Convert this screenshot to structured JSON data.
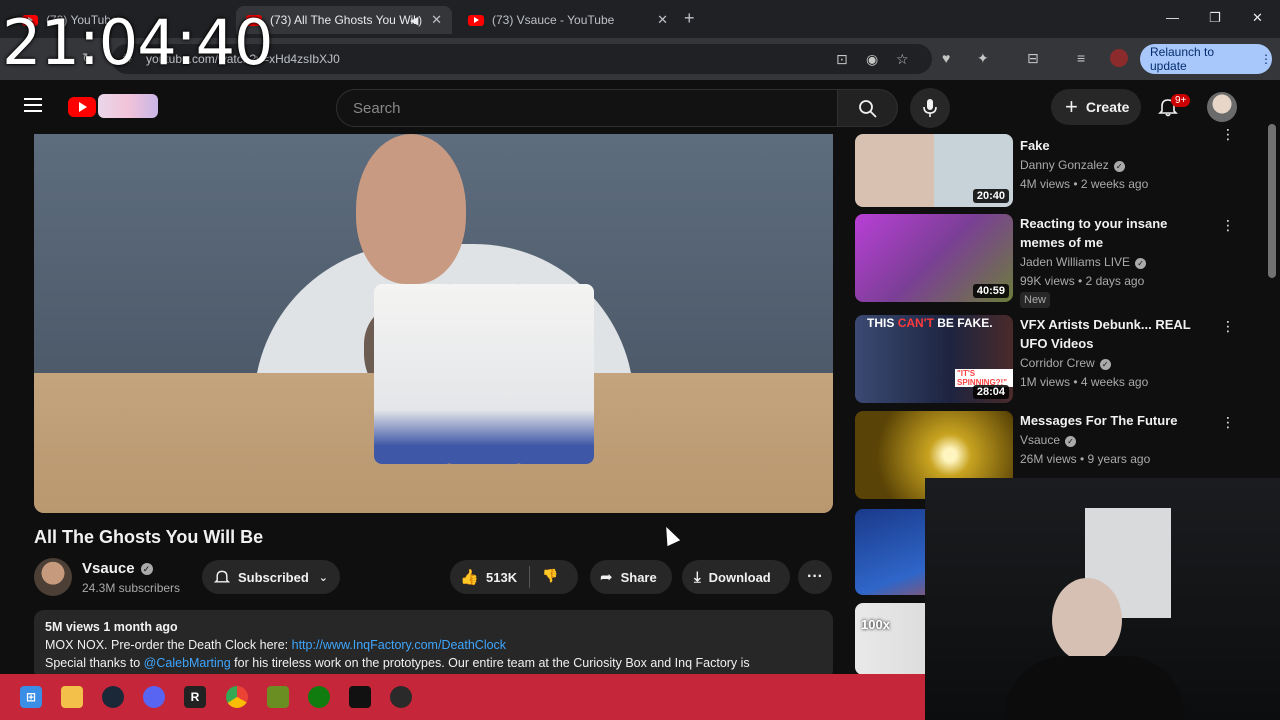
{
  "clock": "21:04:40",
  "browser": {
    "tabs": [
      {
        "title": "(73) YouTube"
      },
      {
        "title": "(73) All The Ghosts You Wil"
      },
      {
        "title": "(73) Vsauce - YouTube"
      }
    ],
    "url": "youtube.com/watch?v=xHd4zsIbXJ0",
    "relaunch_label": "Relaunch to update"
  },
  "header": {
    "search_placeholder": "Search",
    "create_label": "Create",
    "notification_count": "9+"
  },
  "video": {
    "title": "All The Ghosts You Will Be",
    "channel": "Vsauce",
    "subscribers": "24.3M subscribers",
    "subscribed_label": "Subscribed",
    "likes": "513K",
    "share_label": "Share",
    "download_label": "Download"
  },
  "description": {
    "meta": "5M views  1 month ago",
    "line1_text": "MOX NOX. Pre-order the Death Clock here: ",
    "line1_link": "http://www.InqFactory.com/DeathClock",
    "line2_prefix": "Special thanks to ",
    "line2_mention": "@CalebMarting",
    "line2_rest": "  for his tireless work on the prototypes. Our entire team at the Curiosity Box and Inq Factory is"
  },
  "sidebar": [
    {
      "title": "Fake",
      "channel": "Danny Gonzalez",
      "meta": "4M views • 2 weeks ago",
      "duration": "20:40"
    },
    {
      "title": "Reacting to your insane memes of me",
      "channel": "Jaden Williams LIVE",
      "meta": "99K views • 2 days ago",
      "duration": "40:59",
      "badge": "New"
    },
    {
      "title": "VFX Artists Debunk... REAL UFO Videos",
      "channel": "Corridor Crew",
      "meta": "1M views • 4 weeks ago",
      "duration": "28:04",
      "thumb_text_a": "THIS",
      "thumb_text_b": "CAN'T",
      "thumb_text_c": "BE FAKE.",
      "thumb_text_d": "\"IT'S SPINNING?!\""
    },
    {
      "title": "Messages For The Future",
      "channel": "Vsauce",
      "meta": "26M views • 9 years ago"
    },
    {
      "thumb_text": "100x"
    }
  ],
  "taskbar_icons": [
    "windows-icon",
    "explorer-icon",
    "steam-icon",
    "discord-icon",
    "roblox-icon",
    "chrome-icon",
    "minecraft-icon",
    "xbox-icon",
    "capcut-icon",
    "obs-icon"
  ]
}
